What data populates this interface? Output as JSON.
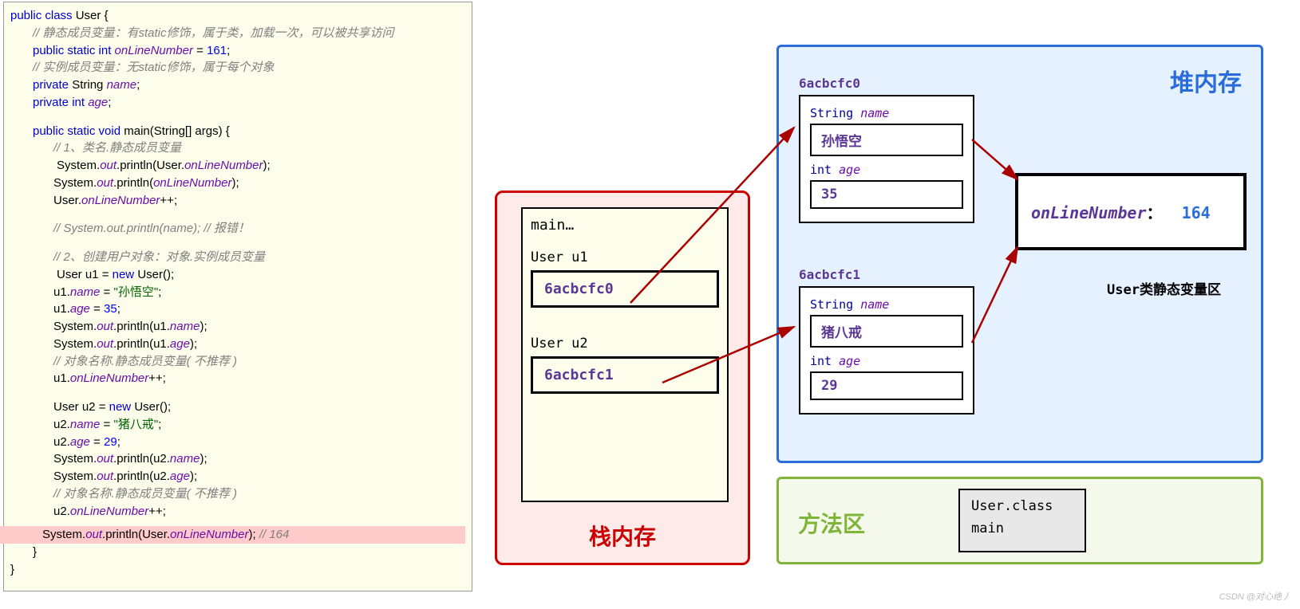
{
  "code": {
    "class_decl_pre": "public class ",
    "class_name": "User",
    "class_brace": " {",
    "cmt_static": "// 静态成员变量：有static修饰，属于类，加载一次，可以被共享访问",
    "static_field_pre": "public static int ",
    "online_field": "onLineNumber",
    "static_field_eq": " = ",
    "static_field_val": "161",
    "semi": ";",
    "cmt_inst": "// 实例成员变量：无static修饰，属于每个对象",
    "private_str": "private ",
    "string_t": "String ",
    "name_f": "name",
    "int_t": "int ",
    "age_f": "age",
    "main_sig_pre": "public static void ",
    "main_name": "main",
    "main_args": "(String[] args) {",
    "cmt_1": "// 1、类名.静态成员变量",
    "sys": "System.",
    "out": "out",
    "println": ".println(",
    "user_dot": "User.",
    "close_p": ");",
    "pp": "++;",
    "cmt_err": "// System.out.println(name); // 报错！",
    "cmt_2": "// 2、创建用户对象：对象.实例成员变量",
    "user_u1": "User u1 = ",
    "new_kw": "new ",
    "user_ctor": "User();",
    "u1_name": "u1.",
    "name_lit": "name",
    "eq": " = ",
    "sun": "\"孙悟空\"",
    "u1_age": "u1.",
    "age_lit": "age",
    "n35": "35",
    "print_u1n_pre": "System.",
    "print_u1n_mid": ".println(u1.",
    "cmt_np": "// 对象名称.静态成员变量( 不推荐 )",
    "user_u2": "User u2 = ",
    "u2_name": "u2.",
    "pig": "\"猪八戒\"",
    "n29": "29",
    "println_u2": ".println(u2.",
    "cmt_164": " // 164",
    "brace_c": "}"
  },
  "stack": {
    "title": "栈内存",
    "frame": "main…",
    "u1_lbl": "User u1",
    "u1_val": "6acbcfc0",
    "u2_lbl": "User u2",
    "u2_val": "6acbcfc1"
  },
  "heap": {
    "title": "堆内存",
    "obj1_addr": "6acbcfc0",
    "obj2_addr": "6acbcfc1",
    "str_t": "String ",
    "name_f": "name",
    "int_t": "int ",
    "age_f": "age",
    "obj1_name": "孙悟空",
    "obj1_age": "35",
    "obj2_name": "猪八戒",
    "obj2_age": "29",
    "static_name": "onLineNumber",
    "static_colon": "：",
    "static_val": "164",
    "static_area_lbl": "User类静态变量区"
  },
  "method": {
    "title": "方法区",
    "cls": "User.class",
    "main": "main"
  },
  "watermark": "CSDN @对心绝丿"
}
